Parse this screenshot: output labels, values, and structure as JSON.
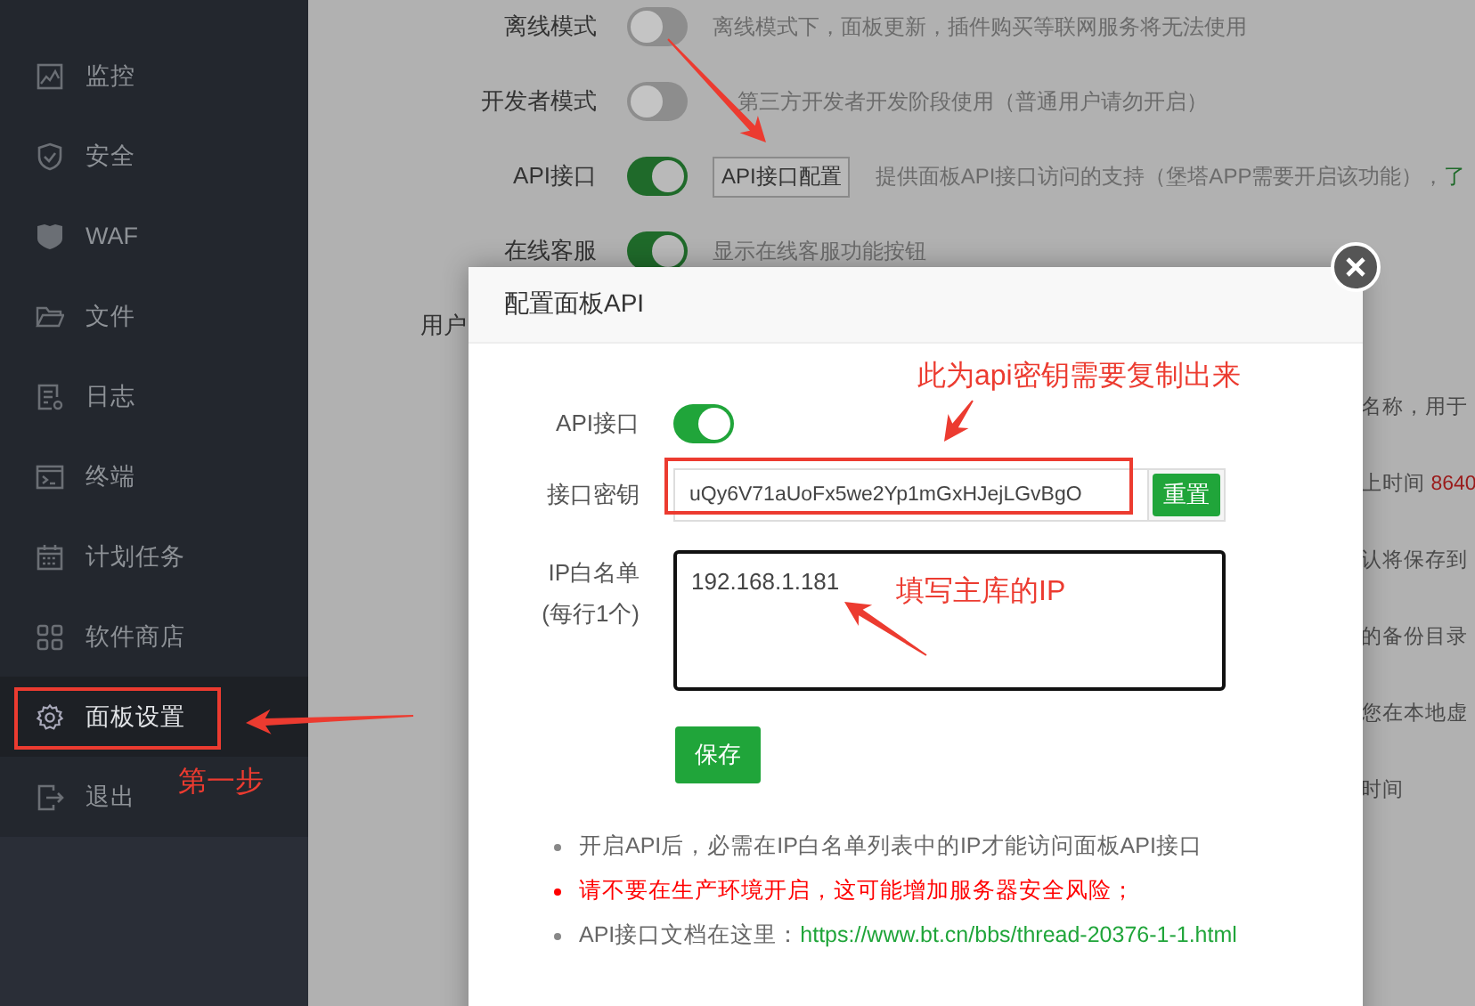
{
  "sidebar": {
    "items": [
      {
        "label": "监控",
        "selected": false
      },
      {
        "label": "安全",
        "selected": false
      },
      {
        "label": "WAF",
        "selected": false
      },
      {
        "label": "文件",
        "selected": false
      },
      {
        "label": "日志",
        "selected": false
      },
      {
        "label": "终端",
        "selected": false
      },
      {
        "label": "计划任务",
        "selected": false
      },
      {
        "label": "软件商店",
        "selected": false
      },
      {
        "label": "面板设置",
        "selected": true
      },
      {
        "label": "退出",
        "selected": false
      }
    ]
  },
  "settings": {
    "rows": [
      {
        "label": "离线模式",
        "on": false,
        "description": "离线模式下，面板更新，插件购买等联网服务将无法使用"
      },
      {
        "label": "开发者模式",
        "on": false,
        "description": "第三方开发者开发阶段使用（普通用户请勿开启）"
      },
      {
        "label": "API接口",
        "on": true,
        "button": "API接口配置",
        "description": "提供面板API接口访问的支持（堡塔APP需要开启该功能），",
        "link": "了"
      },
      {
        "label": "在线客服",
        "on": true,
        "description": "显示在线客服功能按钮"
      }
    ],
    "partial_label": "用户",
    "partial_right": [
      {
        "text": "名称，用于"
      },
      {
        "text": "上时间 ",
        "value": "8640"
      },
      {
        "text": "认将保存到"
      },
      {
        "text": "的备份目录"
      },
      {
        "text": "您在本地虚"
      },
      {
        "text": "时间"
      }
    ]
  },
  "dialog": {
    "title": "配置面板API",
    "api_label": "API接口",
    "api_on": true,
    "key_label": "接口密钥",
    "key_value": "uQy6V71aUoFx5we2Yp1mGxHJejLGvBgO",
    "reset_button": "重置",
    "whitelist_label": "IP白名单",
    "whitelist_hint": "(每行1个)",
    "whitelist_value": "192.168.1.181",
    "save_button": "保存",
    "notes": [
      {
        "kind": "info",
        "text": "开启API后，必需在IP白名单列表中的IP才能访问面板API接口"
      },
      {
        "kind": "warning",
        "text": "请不要在生产环境开启，这可能增加服务器安全风险；"
      },
      {
        "kind": "info",
        "text": "API接口文档在这里：",
        "link": "https://www.bt.cn/bbs/thread-20376-1-1.html"
      }
    ]
  },
  "annotations": [
    {
      "text": "此为api密钥需要复制出来"
    },
    {
      "text": "填写主库的IP"
    },
    {
      "text": "第一步"
    }
  ]
}
